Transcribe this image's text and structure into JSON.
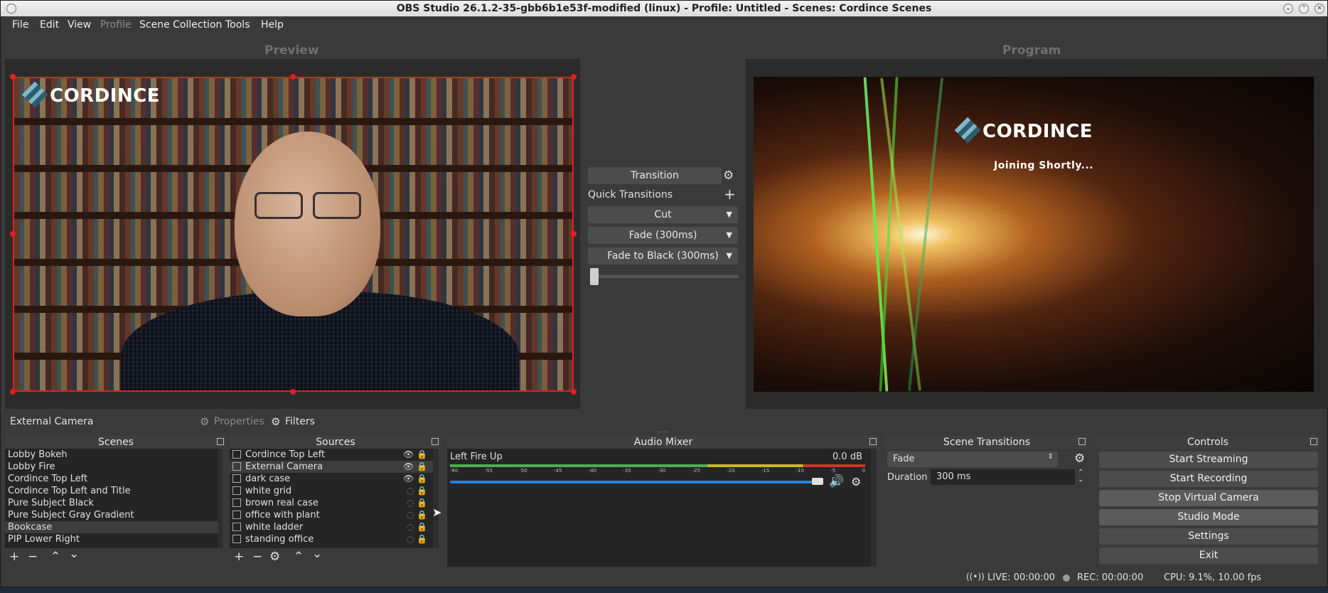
{
  "window": {
    "title": "OBS Studio 26.1.2-35-gbb6b1e53f-modified (linux) - Profile: Untitled - Scenes: Cordince Scenes"
  },
  "menu": [
    "File",
    "Edit",
    "View",
    "Profile",
    "Scene Collection",
    "Tools",
    "Help"
  ],
  "preview": {
    "label": "Preview",
    "logo_text": "CORDINCE"
  },
  "program": {
    "label": "Program",
    "logo_text": "CORDINCE",
    "caption": "Joining Shortly..."
  },
  "transition_panel": {
    "transition_label": "Transition",
    "quick_label": "Quick Transitions",
    "quick": [
      "Cut",
      "Fade (300ms)",
      "Fade to Black (300ms)"
    ],
    "t_bar": 0
  },
  "source_bar": {
    "selected_source": "External Camera",
    "properties_label": "Properties",
    "filters_label": "Filters"
  },
  "scenes": {
    "title": "Scenes",
    "items": [
      "Lobby Bokeh",
      "Lobby Fire",
      "Cordince Top Left",
      "Cordince Top Left and Title",
      "Pure Subject Black",
      "Pure Subject Gray Gradient",
      "Bookcase",
      "PIP Lower Right"
    ],
    "selected": "Bookcase"
  },
  "sources": {
    "title": "Sources",
    "items": [
      {
        "name": "Cordince Top Left",
        "visible": true
      },
      {
        "name": "External Camera",
        "visible": true
      },
      {
        "name": "dark case",
        "visible": true
      },
      {
        "name": "white grid",
        "visible": false
      },
      {
        "name": "brown real case",
        "visible": false
      },
      {
        "name": "office with plant",
        "visible": false
      },
      {
        "name": "white ladder",
        "visible": false
      },
      {
        "name": "standing office",
        "visible": false
      }
    ],
    "selected": "External Camera"
  },
  "audio_mixer": {
    "title": "Audio Mixer",
    "channel_name": "Left Fire Up",
    "level": "0.0 dB",
    "ticks": [
      "-60",
      "-55",
      "-50",
      "-45",
      "-40",
      "-35",
      "-30",
      "-25",
      "-20",
      "-15",
      "-10",
      "-5",
      "0"
    ],
    "fader": 0.99
  },
  "scene_transitions": {
    "title": "Scene Transitions",
    "selected": "Fade",
    "duration_label": "Duration",
    "duration_value": "300 ms"
  },
  "controls": {
    "title": "Controls",
    "buttons": [
      "Start Streaming",
      "Start Recording",
      "Stop Virtual Camera",
      "Studio Mode",
      "Settings",
      "Exit"
    ]
  },
  "status": {
    "live": "LIVE: 00:00:00",
    "rec": "REC: 00:00:00",
    "cpu": "CPU: 9.1%, 10.00 fps"
  },
  "colors": {
    "selection_border": "#e02020",
    "volume_slider": "#2a7fd4",
    "meter_green": "#4caf50",
    "meter_yellow": "#c8b82a",
    "meter_red": "#c83a2a"
  }
}
